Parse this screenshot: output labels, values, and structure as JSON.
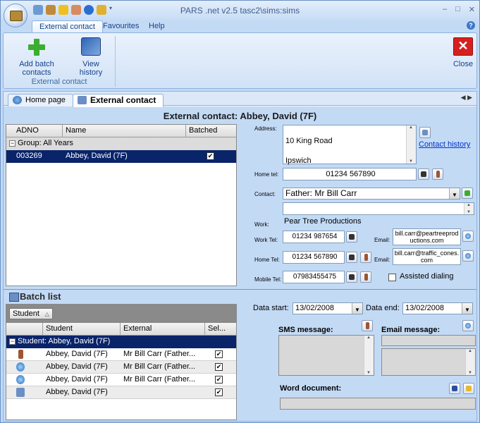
{
  "window": {
    "title": "PARS .net v2.5  tasc2\\sims:sims",
    "minimize": "–",
    "maximize": "□",
    "close": "✕"
  },
  "ribbon": {
    "tabs": [
      "External contact",
      "Favourites",
      "Help"
    ],
    "buttons": {
      "add_batch": "Add batch contacts",
      "view_history": "View history",
      "close": "Close"
    },
    "group_label": "External contact"
  },
  "doc_tabs": [
    "Home page",
    "External contact"
  ],
  "page_title": "External contact: Abbey, David (7F)",
  "contacts_grid": {
    "columns": [
      "ADNO",
      "Name",
      "Batched"
    ],
    "group_label": "Group:  All Years",
    "rows": [
      {
        "adno": "003269",
        "name": "Abbey, David (7F)",
        "batched": true
      }
    ]
  },
  "form": {
    "address_label": "Address:",
    "address_line1": "10 King Road",
    "address_line2": "Ipswich",
    "contact_history": "Contact history",
    "home_tel_label": "Home tel:",
    "home_tel": "01234 567890",
    "contact_label": "Contact:",
    "contact_value": "Father: Mr Bill Carr",
    "work_label": "Work:",
    "work_value": "Pear Tree Productions",
    "work_tel_label": "Work Tel:",
    "work_tel": "01234 987654",
    "email_label": "Email:",
    "work_email": "bill.carr@peartreeproductions.com",
    "home_tel2_label": "Home Tel:",
    "home_tel2": "01234 567890",
    "home_email": "bill.carr@traffic_cones.com",
    "mobile_tel_label": "Mobile Tel:",
    "mobile_tel": "07983455475",
    "assisted_dialing": "Assisted dialing"
  },
  "batch": {
    "title": "Batch list",
    "group_chip": "Student",
    "columns": [
      "Student",
      "External",
      "Sel..."
    ],
    "group_row": "Student:  Abbey, David (7F)",
    "rows": [
      {
        "icon": "mobile-icon",
        "student": "Abbey, David (7F)",
        "external": "Mr Bill Carr (Father...",
        "sel": true
      },
      {
        "icon": "globe-icon",
        "student": "Abbey, David (7F)",
        "external": "Mr Bill Carr (Father...",
        "sel": true
      },
      {
        "icon": "globe-icon",
        "student": "Abbey, David (7F)",
        "external": "Mr Bill Carr (Father...",
        "sel": true
      },
      {
        "icon": "letter-icon",
        "student": "Abbey, David (7F)",
        "external": "",
        "sel": true
      }
    ]
  },
  "dates": {
    "start_label": "Data start:",
    "start": "13/02/2008",
    "end_label": "Data end:",
    "end": "13/02/2008"
  },
  "messages": {
    "sms_label": "SMS message:",
    "email_label": "Email message:",
    "word_label": "Word document:"
  }
}
